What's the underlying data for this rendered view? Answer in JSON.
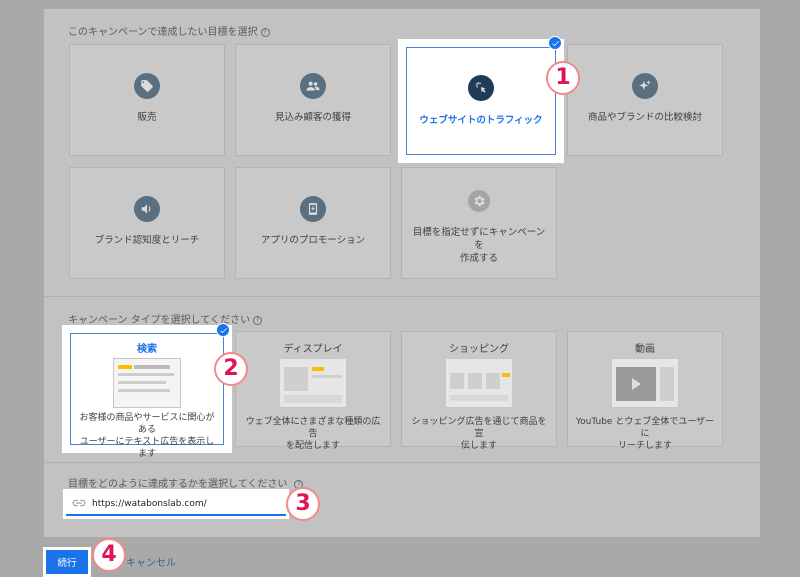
{
  "goal_section": {
    "title": "このキャンペーンで達成したい目標を選択",
    "help": "?",
    "goals": [
      {
        "label": "販売",
        "icon": "tag-icon"
      },
      {
        "label": "見込み顧客の獲得",
        "icon": "people-icon"
      },
      {
        "label": "ウェブサイトのトラフィック",
        "icon": "cursor-click-icon",
        "selected": true
      },
      {
        "label": "商品やブランドの比較検討",
        "icon": "sparkle-icon"
      },
      {
        "label": "ブランド認知度とリーチ",
        "icon": "speaker-icon"
      },
      {
        "label": "アプリのプロモーション",
        "icon": "phone-icon"
      },
      {
        "label_line1": "目標を指定せずにキャンペーンを",
        "label_line2": "作成する",
        "icon": "gear-icon"
      }
    ]
  },
  "type_section": {
    "title": "キャンペーン タイプを選択してください",
    "help": "?",
    "types": [
      {
        "title": "検索",
        "desc_line1": "お客様の商品やサービスに関心がある",
        "desc_line2": "ユーザーにテキスト広告を表示し",
        "desc_line3": "ます",
        "selected": true
      },
      {
        "title": "ディスプレイ",
        "desc_line1": "ウェブ全体にさまざまな種類の広告",
        "desc_line2": "を配信します"
      },
      {
        "title": "ショッピング",
        "desc_line1": "ショッピング広告を通じて商品を宣",
        "desc_line2": "伝します"
      },
      {
        "title": "動画",
        "desc_line1": "YouTube とウェブ全体でユーザーに",
        "desc_line2": "リーチします"
      }
    ]
  },
  "url_section": {
    "title": "目標をどのように達成するかを選択してください",
    "help": "?",
    "url_value": "https://watabonslab.com/"
  },
  "actions": {
    "continue_label": "続行",
    "cancel_label": "キャンセル"
  },
  "annotations": [
    "1",
    "2",
    "3",
    "4"
  ],
  "colors": {
    "accent": "#1a73e8",
    "badge": "#e0145a"
  }
}
